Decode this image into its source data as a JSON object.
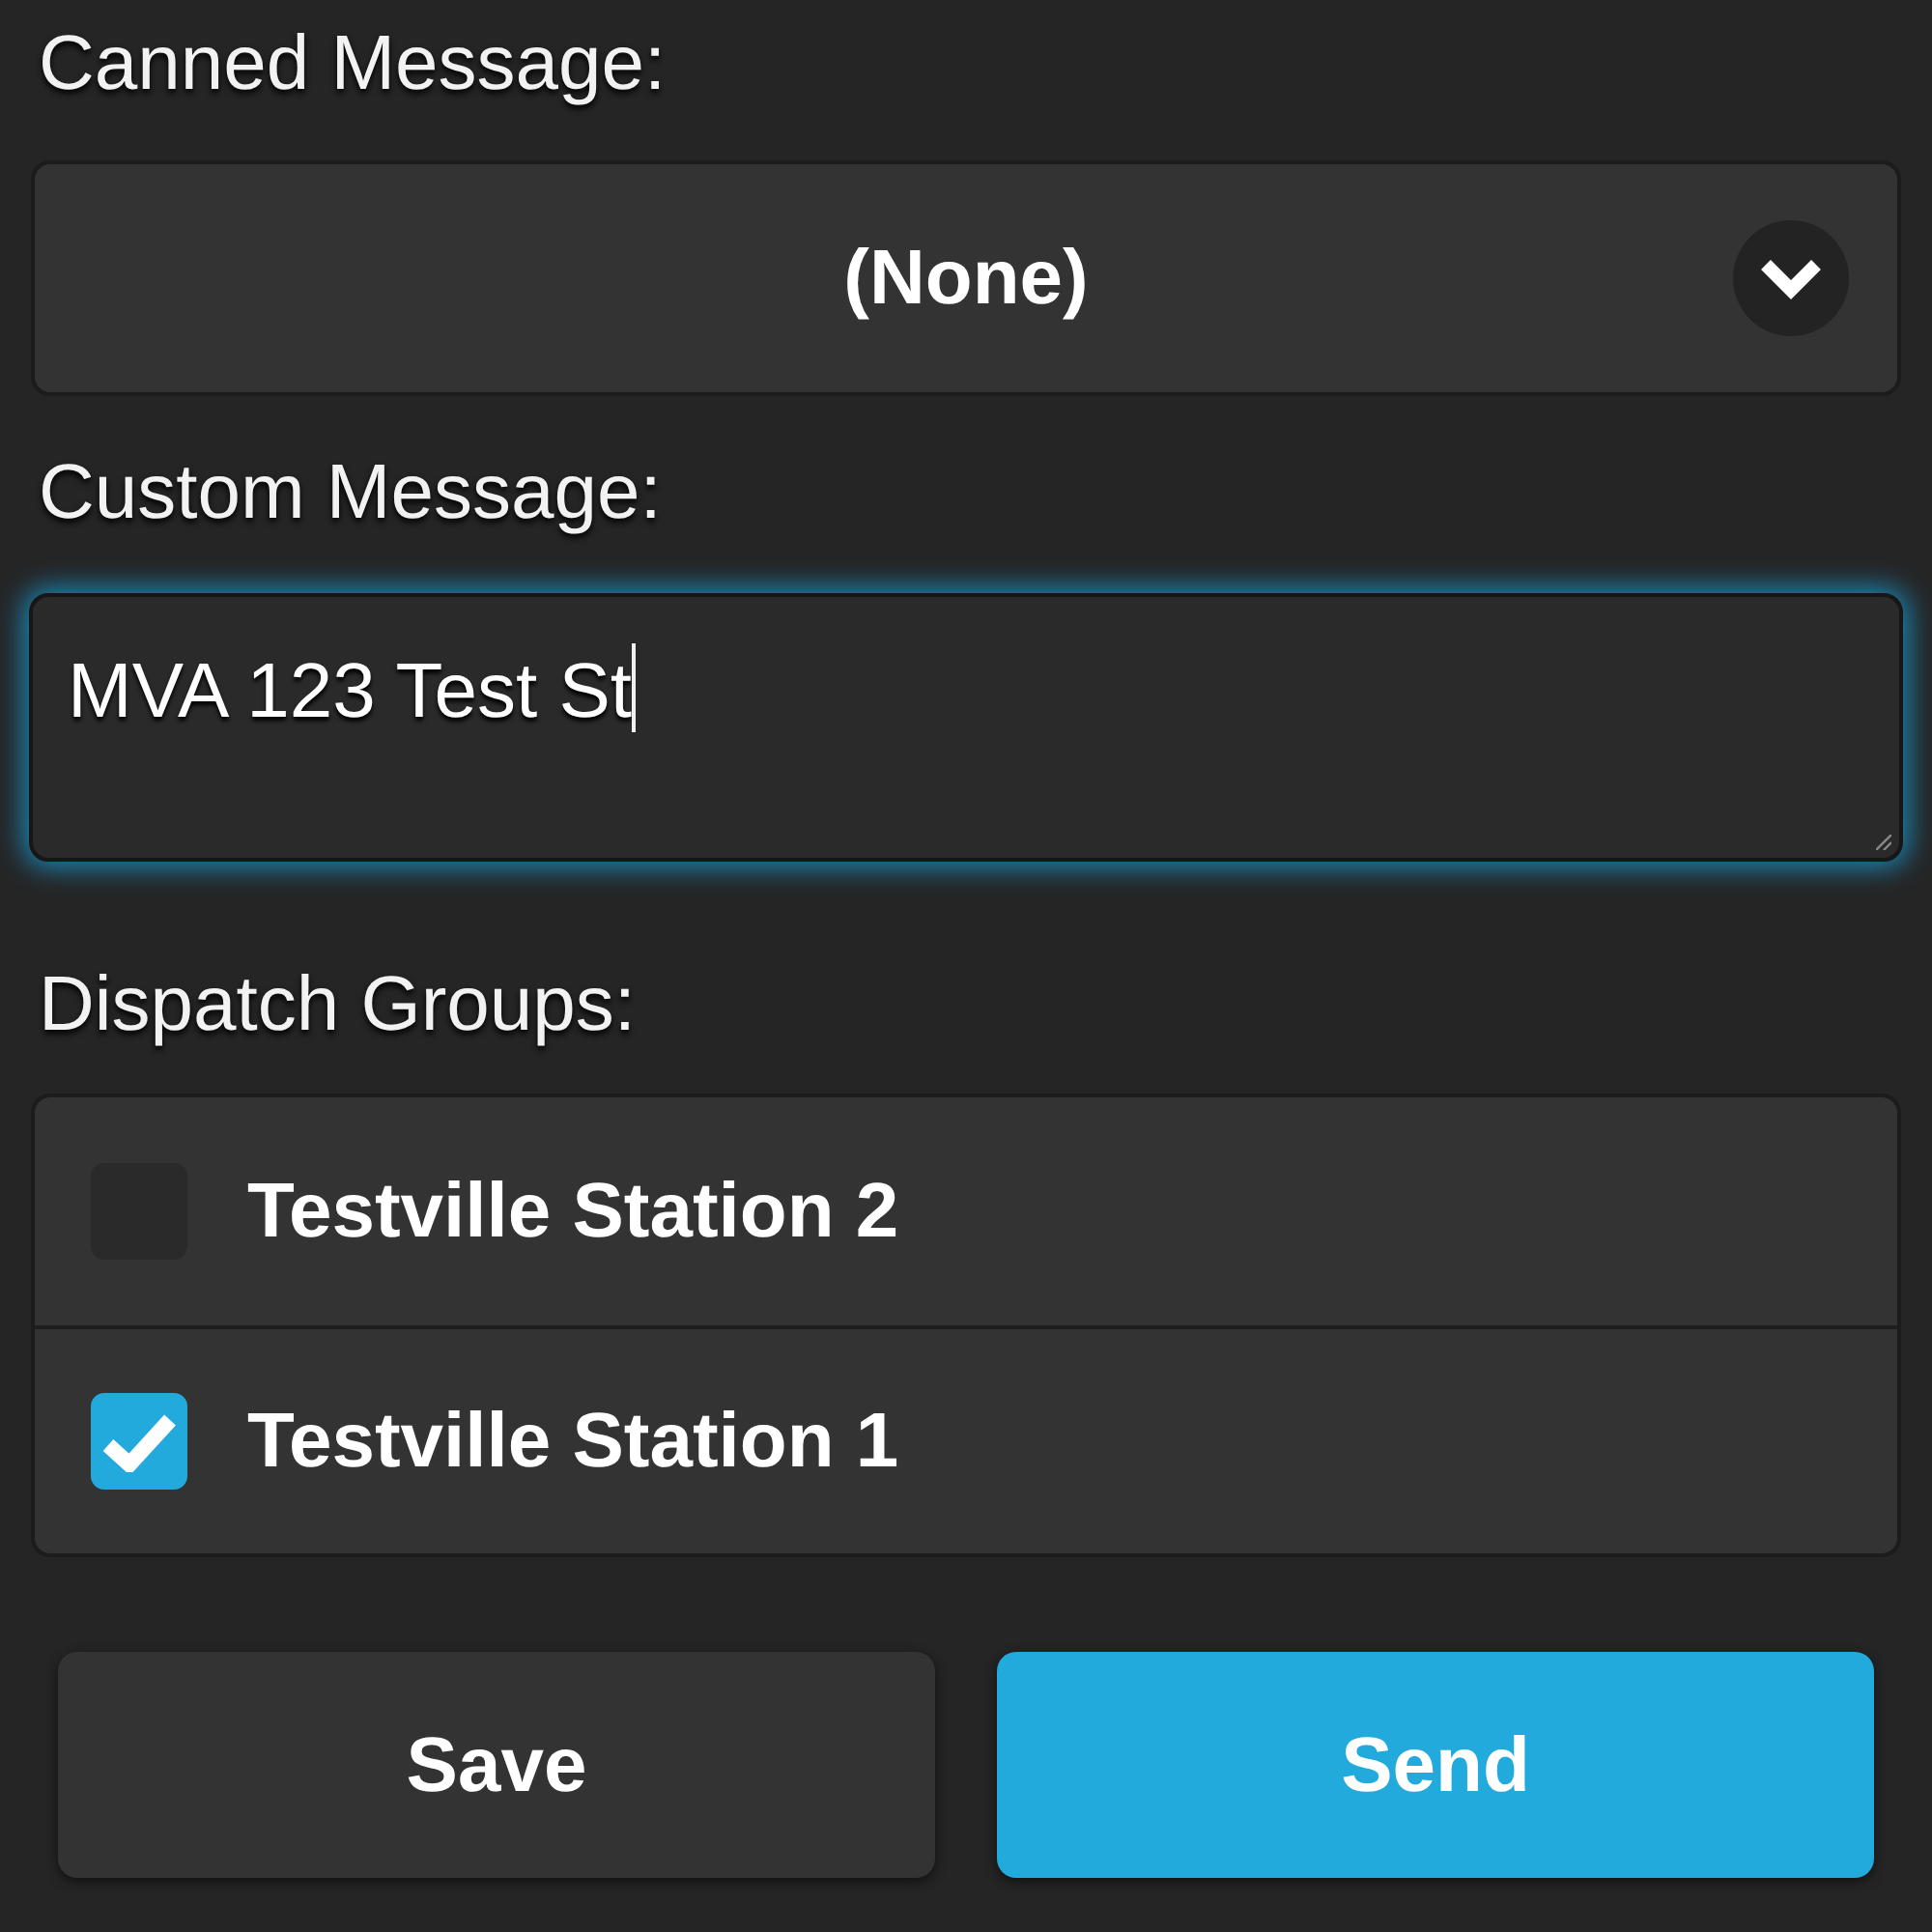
{
  "canned_message": {
    "label": "Canned Message:",
    "value": "(None)"
  },
  "custom_message": {
    "label": "Custom Message:",
    "value": "MVA 123 Test St",
    "focused": true
  },
  "dispatch_groups": {
    "label": "Dispatch Groups:",
    "items": [
      {
        "label": "Testville Station 2",
        "checked": false
      },
      {
        "label": "Testville Station 1",
        "checked": true
      }
    ]
  },
  "buttons": [
    {
      "label": "Save",
      "kind": "secondary"
    },
    {
      "label": "Send",
      "kind": "primary"
    }
  ]
}
